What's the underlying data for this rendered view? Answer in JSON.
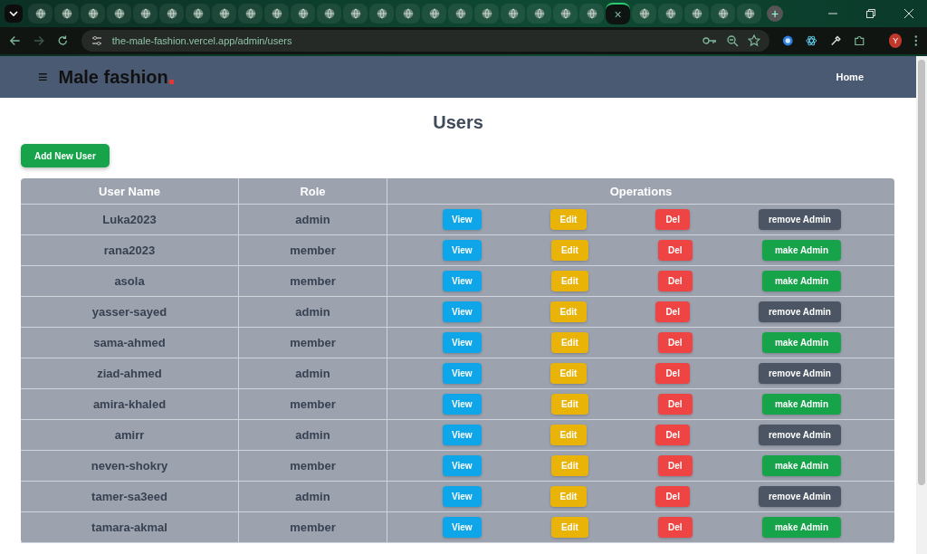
{
  "browser": {
    "tabs": [
      {
        "selected": false
      },
      {
        "selected": false
      },
      {
        "selected": false
      },
      {
        "selected": false
      },
      {
        "selected": false
      },
      {
        "selected": false
      },
      {
        "selected": false
      },
      {
        "selected": false
      },
      {
        "selected": false
      },
      {
        "selected": false
      },
      {
        "selected": false
      },
      {
        "selected": false
      },
      {
        "selected": false
      },
      {
        "selected": false
      },
      {
        "selected": false
      },
      {
        "selected": false
      },
      {
        "selected": false
      },
      {
        "selected": false
      },
      {
        "selected": false
      },
      {
        "selected": false
      },
      {
        "selected": false
      },
      {
        "selected": false
      },
      {
        "selected": true,
        "close": "×"
      },
      {
        "selected": false
      },
      {
        "selected": false
      },
      {
        "selected": false
      },
      {
        "selected": false
      },
      {
        "selected": false
      }
    ],
    "new_tab": "+",
    "url": "the-male-fashion.vercel.app/admin/users",
    "profile": "Y"
  },
  "navbar": {
    "menu": "≡",
    "logo": "Male fashion",
    "links": [
      "Home"
    ]
  },
  "title": "Users",
  "add_button": "Add New User",
  "table": {
    "columns": [
      "User Name",
      "Role",
      "Operations"
    ],
    "rows": [
      {
        "name": "Luka2023",
        "role": "admin",
        "buttons": [
          {
            "label": "View",
            "kind": "view"
          },
          {
            "label": "Edit",
            "kind": "edit"
          },
          {
            "label": "Del",
            "kind": "del"
          },
          {
            "label": "remove Admin",
            "kind": "remove"
          }
        ]
      },
      {
        "name": "rana2023",
        "role": "member",
        "buttons": [
          {
            "label": "View",
            "kind": "view"
          },
          {
            "label": "Edit",
            "kind": "edit"
          },
          {
            "label": "Del",
            "kind": "del"
          },
          {
            "label": "make Admin",
            "kind": "make"
          }
        ]
      },
      {
        "name": "asola",
        "role": "member",
        "buttons": [
          {
            "label": "View",
            "kind": "view"
          },
          {
            "label": "Edit",
            "kind": "edit"
          },
          {
            "label": "Del",
            "kind": "del"
          },
          {
            "label": "make Admin",
            "kind": "make"
          }
        ]
      },
      {
        "name": "yasser-sayed",
        "role": "admin",
        "buttons": [
          {
            "label": "View",
            "kind": "view"
          },
          {
            "label": "Edit",
            "kind": "edit"
          },
          {
            "label": "Del",
            "kind": "del"
          },
          {
            "label": "remove Admin",
            "kind": "remove"
          }
        ]
      },
      {
        "name": "sama-ahmed",
        "role": "member",
        "buttons": [
          {
            "label": "View",
            "kind": "view"
          },
          {
            "label": "Edit",
            "kind": "edit"
          },
          {
            "label": "Del",
            "kind": "del"
          },
          {
            "label": "make Admin",
            "kind": "make"
          }
        ]
      },
      {
        "name": "ziad-ahmed",
        "role": "admin",
        "buttons": [
          {
            "label": "View",
            "kind": "view"
          },
          {
            "label": "Edit",
            "kind": "edit"
          },
          {
            "label": "Del",
            "kind": "del"
          },
          {
            "label": "remove Admin",
            "kind": "remove"
          }
        ]
      },
      {
        "name": "amira-khaled",
        "role": "member",
        "buttons": [
          {
            "label": "View",
            "kind": "view"
          },
          {
            "label": "Edit",
            "kind": "edit"
          },
          {
            "label": "Del",
            "kind": "del"
          },
          {
            "label": "make Admin",
            "kind": "make"
          }
        ]
      },
      {
        "name": "amirr",
        "role": "admin",
        "buttons": [
          {
            "label": "View",
            "kind": "view"
          },
          {
            "label": "Edit",
            "kind": "edit"
          },
          {
            "label": "Del",
            "kind": "del"
          },
          {
            "label": "remove Admin",
            "kind": "remove"
          }
        ]
      },
      {
        "name": "neven-shokry",
        "role": "member",
        "buttons": [
          {
            "label": "View",
            "kind": "view"
          },
          {
            "label": "Edit",
            "kind": "edit"
          },
          {
            "label": "Del",
            "kind": "del"
          },
          {
            "label": "make Admin",
            "kind": "make"
          }
        ]
      },
      {
        "name": "tamer-sa3eed",
        "role": "admin",
        "buttons": [
          {
            "label": "View",
            "kind": "view"
          },
          {
            "label": "Edit",
            "kind": "edit"
          },
          {
            "label": "Del",
            "kind": "del"
          },
          {
            "label": "remove Admin",
            "kind": "remove"
          }
        ]
      },
      {
        "name": "tamara-akmal",
        "role": "member",
        "buttons": [
          {
            "label": "View",
            "kind": "view"
          },
          {
            "label": "Edit",
            "kind": "edit"
          },
          {
            "label": "Del",
            "kind": "del"
          },
          {
            "label": "make Admin",
            "kind": "make"
          }
        ]
      }
    ]
  }
}
